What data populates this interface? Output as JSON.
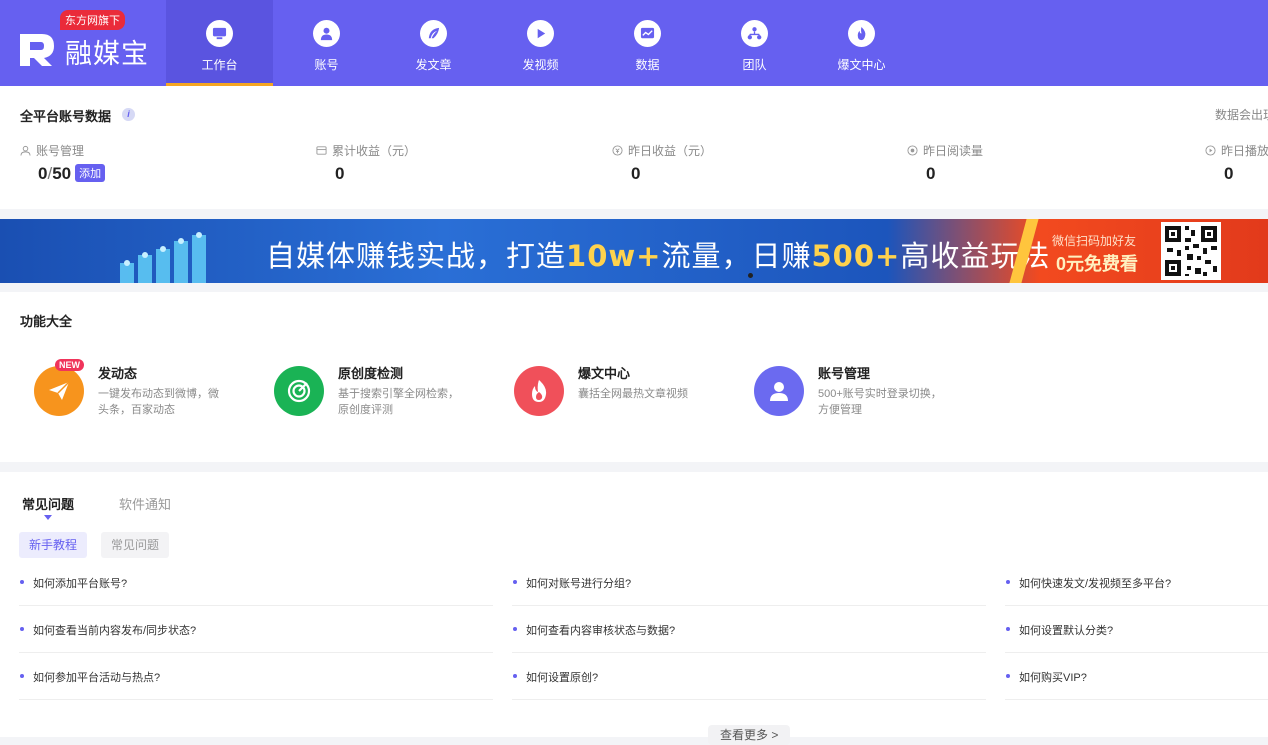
{
  "brand": {
    "badge": "东方网旗下",
    "name": "融媒宝",
    "color": "#6660f0"
  },
  "nav": [
    {
      "label": "工作台",
      "icon": "monitor-icon",
      "active": true
    },
    {
      "label": "账号",
      "icon": "user-icon"
    },
    {
      "label": "发文章",
      "icon": "feather-icon"
    },
    {
      "label": "发视频",
      "icon": "play-icon"
    },
    {
      "label": "数据",
      "icon": "chart-icon"
    },
    {
      "label": "团队",
      "icon": "team-icon"
    },
    {
      "label": "爆文中心",
      "icon": "fire-icon"
    }
  ],
  "stats": {
    "title": "全平台账号数据",
    "export_label": "数据会出现",
    "accounts": {
      "label": "账号管理",
      "used": "0",
      "sep": "/",
      "total": "50",
      "add_label": "添加"
    },
    "total_income": {
      "label": "累计收益（元）",
      "value": "0"
    },
    "yesterday_income": {
      "label": "昨日收益（元）",
      "value": "0"
    },
    "yesterday_reads": {
      "label": "昨日阅读量",
      "value": "0"
    },
    "yesterday_plays": {
      "label": "昨日播放",
      "value": "0"
    }
  },
  "banner": {
    "text_a": "自媒体赚钱实战，打造",
    "text_hl1": "10w+",
    "text_b": "流量，日赚",
    "text_hl2": "500+",
    "text_c": "高收益玩法",
    "sub1": "微信扫码加好友",
    "sub2": "0元免费看"
  },
  "features": {
    "title": "功能大全",
    "items": [
      {
        "title": "发动态",
        "desc": "一键发布动态到微博，微头条，百家动态",
        "badge": "NEW",
        "icon": "send-icon",
        "color": "#f7941d"
      },
      {
        "title": "原创度检测",
        "desc": "基于搜索引擎全网检索，原创度评测",
        "icon": "radar-icon",
        "color": "#1ab355"
      },
      {
        "title": "爆文中心",
        "desc": "囊括全网最热文章视频",
        "icon": "flame-icon",
        "color": "#f0505a"
      },
      {
        "title": "账号管理",
        "desc": "500+账号实时登录切换，方便管理",
        "icon": "account-icon",
        "color": "#6b6af0"
      }
    ]
  },
  "faq": {
    "tabs": [
      "常见问题",
      "软件通知"
    ],
    "chips": [
      "新手教程",
      "常见问题"
    ],
    "questions": [
      "如何添加平台账号?",
      "如何对账号进行分组?",
      "如何快速发文/发视频至多平台?",
      "如何查看当前内容发布/同步状态?",
      "如何查看内容审核状态与数据?",
      "如何设置默认分类?",
      "如何参加平台活动与热点?",
      "如何设置原创?",
      "如何购买VIP?"
    ],
    "more_label": "查看更多 >"
  }
}
